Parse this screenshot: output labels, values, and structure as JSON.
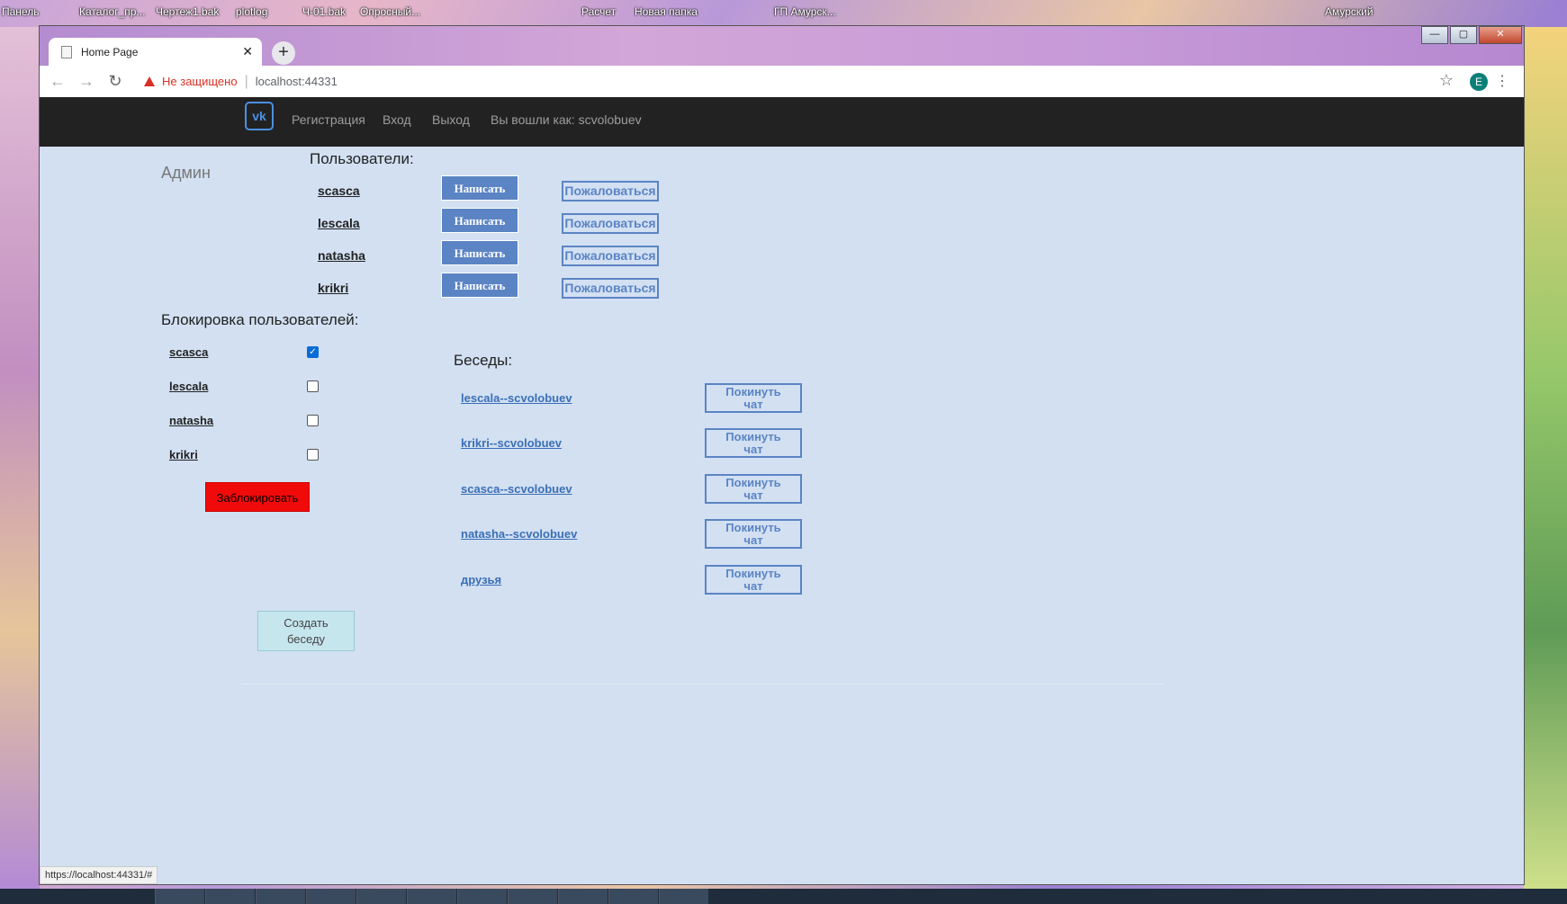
{
  "desktop": {
    "icons": [
      "Панель",
      "Каталог_пр...",
      "Чертеж1.bak",
      "plotlog",
      "Ч-01.bak",
      "Опросный...",
      "Расчет",
      "Новая папка",
      "ГП Амурск...",
      "Амурский"
    ]
  },
  "browser": {
    "tab_title": "Home Page",
    "new_tab": "+",
    "security_label": "Не защищено",
    "url": "localhost:44331",
    "profile_initial": "E",
    "status_url": "https://localhost:44331/#"
  },
  "nav": {
    "register": "Регистрация",
    "login": "Вход",
    "logout": "Выход",
    "logged_in_as": "Вы вошли как: scvolobuev"
  },
  "admin_label": "Админ",
  "users": {
    "heading": "Пользователи:",
    "write_label": "Написать",
    "report_label": "Пожаловаться",
    "list": [
      "scasca",
      "lescala",
      "natasha",
      "krikri"
    ]
  },
  "block": {
    "heading": "Блокировка пользователей:",
    "items": [
      {
        "name": "scasca",
        "checked": true
      },
      {
        "name": "lescala",
        "checked": false
      },
      {
        "name": "natasha",
        "checked": false
      },
      {
        "name": "krikri",
        "checked": false
      }
    ],
    "button_label": "Заблокировать"
  },
  "chats": {
    "heading": "Беседы:",
    "leave_label_line1": "Покинуть",
    "leave_label_line2": "чат",
    "list": [
      "lescala--scvolobuev",
      "krikri--scvolobuev",
      "scasca--scvolobuev",
      "natasha--scvolobuev",
      "друзья"
    ]
  },
  "create_chat": {
    "line1": "Создать",
    "line2": "беседу"
  },
  "colors": {
    "page_bg": "#d2e0f2",
    "navbar_bg": "#222222",
    "button_blue": "#5b84c4",
    "block_button": "#f10a0a",
    "create_button": "#c6e6ee"
  }
}
